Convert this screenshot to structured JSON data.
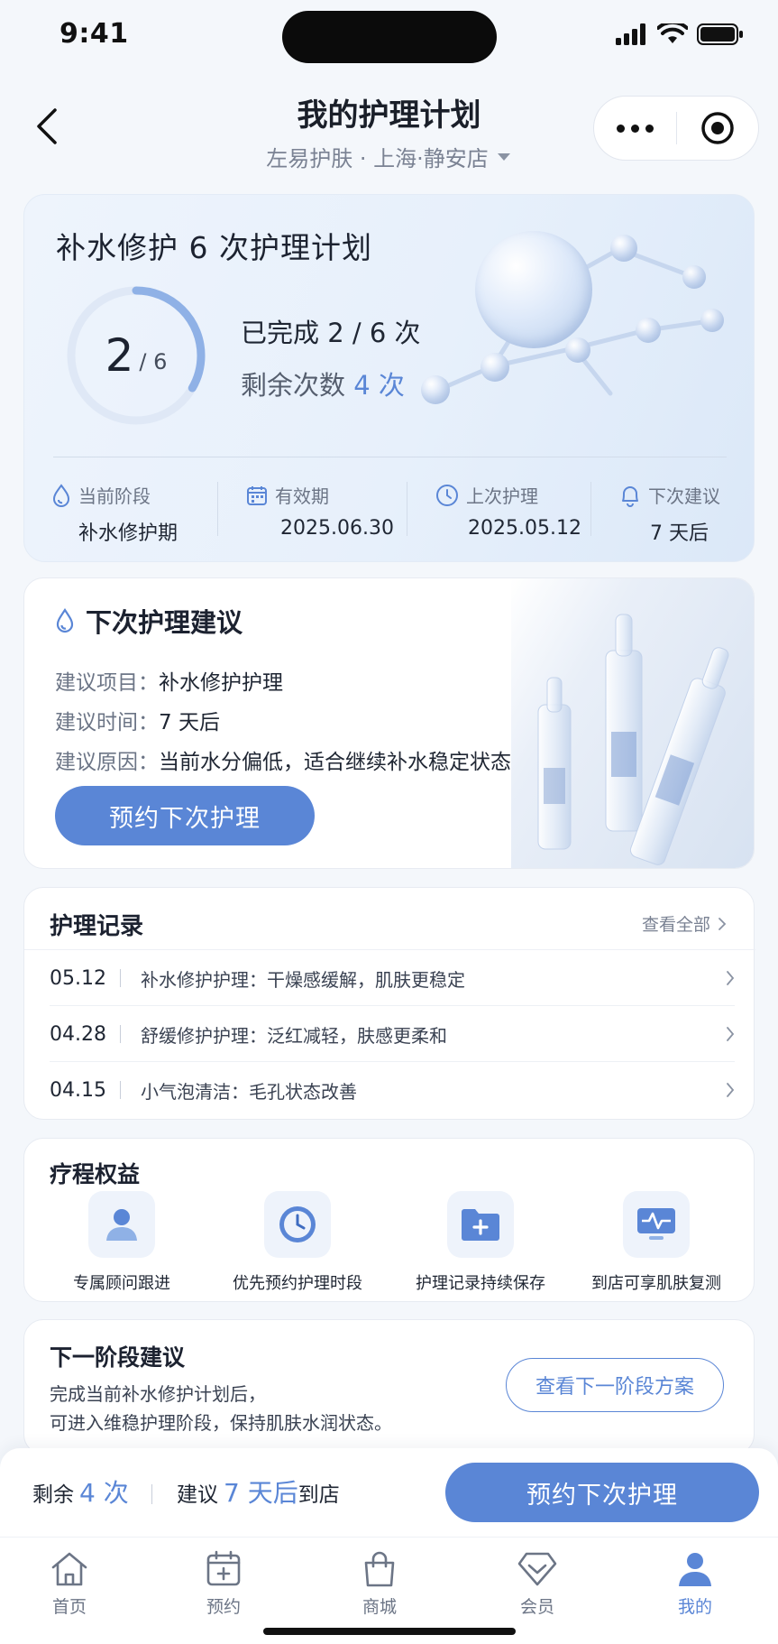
{
  "status_bar": {
    "time": "9:41"
  },
  "header": {
    "title": "我的护理计划",
    "store": "左易护肤 · 上海·静安店"
  },
  "plan": {
    "title": "补水修护 6 次护理计划",
    "completed": 2,
    "total": 6,
    "completed_text": "已完成 2 / 6 次",
    "remaining_label": "剩余次数",
    "remaining_value": "4 次",
    "stats": [
      {
        "label": "当前阶段",
        "value": "补水修护期",
        "icon": "drop-icon"
      },
      {
        "label": "有效期",
        "value": "2025.06.30",
        "icon": "calendar-icon"
      },
      {
        "label": "上次护理",
        "value": "2025.05.12",
        "icon": "clock-icon"
      },
      {
        "label": "下次建议",
        "value": "7 天后",
        "icon": "bell-icon"
      }
    ]
  },
  "next_care": {
    "title": "下次护理建议",
    "rows": [
      {
        "key": "建议项目：",
        "value": "补水修护护理"
      },
      {
        "key": "建议时间：",
        "value": "7 天后"
      },
      {
        "key": "建议原因：",
        "value": "当前水分偏低，适合继续补水稳定状态"
      }
    ],
    "button": "预约下次护理"
  },
  "records": {
    "title": "护理记录",
    "view_all": "查看全部",
    "items": [
      {
        "date": "05.12",
        "text": "补水修护护理：干燥感缓解，肌肤更稳定"
      },
      {
        "date": "04.28",
        "text": "舒缓修护护理：泛红减轻，肤感更柔和"
      },
      {
        "date": "04.15",
        "text": "小气泡清洁：毛孔状态改善"
      }
    ]
  },
  "benefits": {
    "title": "疗程权益",
    "items": [
      {
        "label": "专属顾问跟进",
        "icon": "advisor-icon"
      },
      {
        "label": "优先预约护理时段",
        "icon": "clock-icon"
      },
      {
        "label": "护理记录持续保存",
        "icon": "folder-add-icon"
      },
      {
        "label": "到店可享肌肤复测",
        "icon": "monitor-pulse-icon"
      }
    ]
  },
  "next_stage": {
    "title": "下一阶段建议",
    "line1": "完成当前补水修护计划后，",
    "line2": "可进入维稳护理阶段，保持肌肤水润状态。",
    "button": "查看下一阶段方案"
  },
  "action_bar": {
    "remain_label": "剩余",
    "remain_value": "4 次",
    "suggest_label": "建议",
    "suggest_value": "7 天后",
    "suggest_suffix": "到店",
    "button": "预约下次护理"
  },
  "tabs": [
    {
      "label": "首页",
      "icon": "home-icon"
    },
    {
      "label": "预约",
      "icon": "calendar-plus-icon"
    },
    {
      "label": "商城",
      "icon": "shopping-bag-icon"
    },
    {
      "label": "会员",
      "icon": "diamond-icon"
    },
    {
      "label": "我的",
      "icon": "user-icon",
      "active": true
    }
  ],
  "colors": {
    "accent": "#5a86d6",
    "ring_track": "#dfe8f6",
    "text": "#1f2633",
    "muted": "#6c7586"
  }
}
